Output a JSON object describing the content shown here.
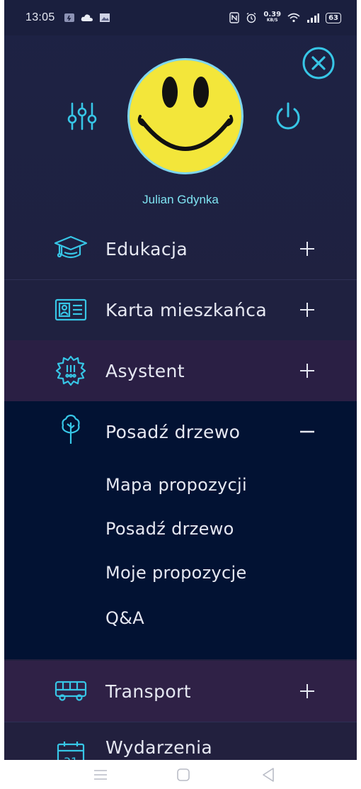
{
  "status_bar": {
    "time": "13:05",
    "net_speed_value": "0.39",
    "net_speed_unit": "KB/S",
    "battery": "63"
  },
  "header": {
    "user_name": "Julian Gdynka"
  },
  "menu": {
    "items": [
      {
        "label": "Edukacja",
        "icon": "graduation-cap-icon",
        "toggle": "+"
      },
      {
        "label": "Karta mieszkańca",
        "icon": "id-card-icon",
        "toggle": "+"
      },
      {
        "label": "Asystent",
        "icon": "assistant-gear-icon",
        "toggle": "+"
      },
      {
        "label": "Posadź drzewo",
        "icon": "tree-icon",
        "toggle": "−",
        "subitems": [
          "Mapa propozycji",
          "Posadź drzewo",
          "Moje propozycje",
          "Q&A"
        ]
      },
      {
        "label": "Transport",
        "icon": "bus-icon",
        "toggle": "+"
      },
      {
        "label": "Wydarzenia",
        "icon": "calendar-icon",
        "calendar_day": "31"
      }
    ]
  },
  "colors": {
    "accent": "#37c6e6",
    "text": "#e6e8f2",
    "expanded_bg": "#021233",
    "drawer_bg": "#1f2140"
  }
}
